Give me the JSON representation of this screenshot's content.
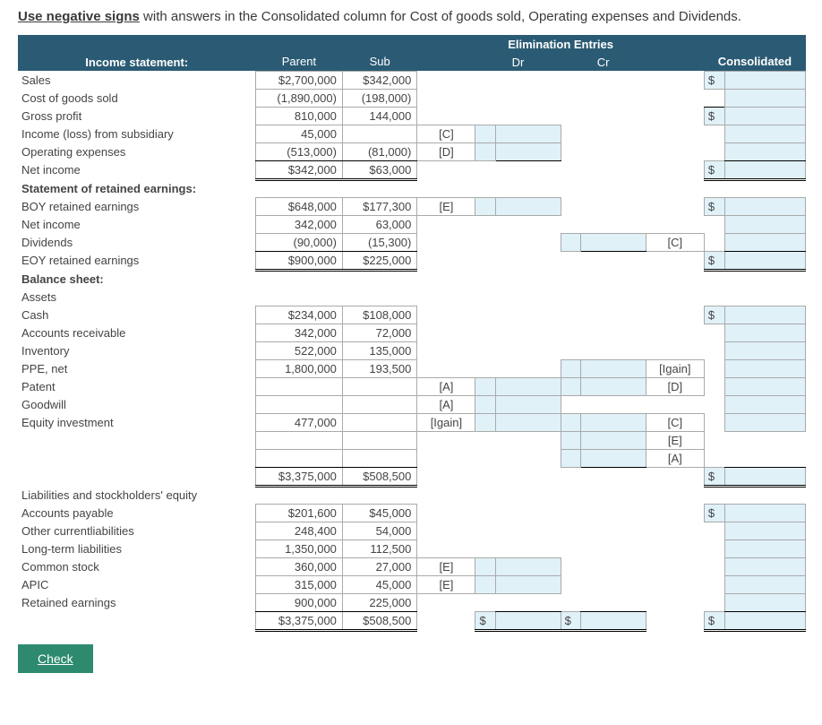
{
  "instruction_lead": "Use negative signs",
  "instruction_rest": " with answers in the Consolidated column for Cost of goods sold, Operating expenses and Dividends.",
  "headers": {
    "elim": "Elimination Entries",
    "stmt": "Income statement:",
    "parent": "Parent",
    "sub": "Sub",
    "dr": "Dr",
    "cr": "Cr",
    "cons": "Consolidated"
  },
  "rows": {
    "sales": {
      "label": "Sales",
      "parent": "$2,700,000",
      "sub": "$342,000"
    },
    "cogs": {
      "label": "Cost of goods sold",
      "parent": "(1,890,000)",
      "sub": "(198,000)"
    },
    "gp": {
      "label": "Gross profit",
      "parent": "810,000",
      "sub": "144,000"
    },
    "incsub": {
      "label": "Income (loss) from subsidiary",
      "parent": "45,000",
      "code1": "[C]"
    },
    "opex": {
      "label": "Operating expenses",
      "parent": "(513,000)",
      "sub": "(81,000)",
      "code1": "[D]"
    },
    "ni": {
      "label": "Net income",
      "parent": "$342,000",
      "sub": "$63,000"
    },
    "sre_hdr": "Statement of retained earnings:",
    "boyre": {
      "label": "BOY retained earnings",
      "parent": "$648,000",
      "sub": "$177,300",
      "code1": "[E]"
    },
    "ni2": {
      "label": "Net income",
      "parent": "342,000",
      "sub": "63,000"
    },
    "div": {
      "label": "Dividends",
      "parent": "(90,000)",
      "sub": "(15,300)",
      "code2": "[C]"
    },
    "eoyre": {
      "label": "EOY retained earnings",
      "parent": "$900,000",
      "sub": "$225,000"
    },
    "bs_hdr": "Balance sheet:",
    "assets": "Assets",
    "cash": {
      "label": "Cash",
      "parent": "$234,000",
      "sub": "$108,000"
    },
    "ar": {
      "label": "Accounts receivable",
      "parent": "342,000",
      "sub": "72,000"
    },
    "inv": {
      "label": "Inventory",
      "parent": "522,000",
      "sub": "135,000"
    },
    "ppe": {
      "label": "PPE, net",
      "parent": "1,800,000",
      "sub": "193,500",
      "code2": "[Igain]"
    },
    "patent": {
      "label": "Patent",
      "code1": "[A]",
      "code2": "[D]"
    },
    "gw": {
      "label": "Goodwill",
      "code1": "[A]"
    },
    "eqinv": {
      "label": "Equity investment",
      "parent": "477,000",
      "code1": "[Igain]",
      "code2": "[C]"
    },
    "blank1": {
      "code2": "[E]"
    },
    "blank2": {
      "code2": "[A]"
    },
    "tot1": {
      "parent": "$3,375,000",
      "sub": "$508,500"
    },
    "lse": "Liabilities and stockholders' equity",
    "ap": {
      "label": "Accounts payable",
      "parent": "$201,600",
      "sub": "$45,000"
    },
    "ocl": {
      "label": "Other currentliabilities",
      "parent": "248,400",
      "sub": "54,000"
    },
    "ltl": {
      "label": "Long-term liabilities",
      "parent": "1,350,000",
      "sub": "112,500"
    },
    "cs": {
      "label": "Common stock",
      "parent": "360,000",
      "sub": "27,000",
      "code1": "[E]"
    },
    "apic": {
      "label": "APIC",
      "parent": "315,000",
      "sub": "45,000",
      "code1": "[E]"
    },
    "re3": {
      "label": "Retained earnings",
      "parent": "900,000",
      "sub": "225,000"
    },
    "tot2": {
      "parent": "$3,375,000",
      "sub": "$508,500"
    }
  },
  "sym": "$",
  "check": "Check"
}
